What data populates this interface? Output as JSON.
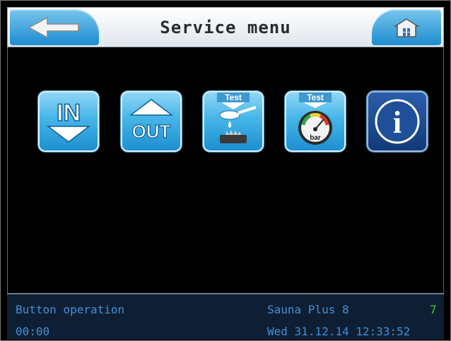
{
  "header": {
    "title": "Service menu",
    "back_icon": "arrow-left-icon",
    "home_icon": "home-icon"
  },
  "menu": {
    "items": [
      {
        "name": "in-button",
        "label": "IN",
        "icon": "download-in-icon"
      },
      {
        "name": "out-button",
        "label": "OUT",
        "icon": "upload-out-icon"
      },
      {
        "name": "test-dosing-button",
        "label": "Test",
        "icon": "dosing-test-icon"
      },
      {
        "name": "test-pressure-button",
        "label": "Test",
        "gauge_label": "bar",
        "icon": "pressure-gauge-icon"
      },
      {
        "name": "info-button",
        "label": "i",
        "icon": "info-icon"
      }
    ]
  },
  "status": {
    "mode": "Button operation",
    "timer": "00:00",
    "program": "Sauna Plus 8",
    "program_number": "7",
    "datetime": "Wed 31.12.14 12:33:52"
  },
  "colors": {
    "button_blue": "#1e8cd0",
    "status_text": "#3f8fd6",
    "status_highlight": "#2fcf2f",
    "status_bg": "#0f1f33"
  }
}
